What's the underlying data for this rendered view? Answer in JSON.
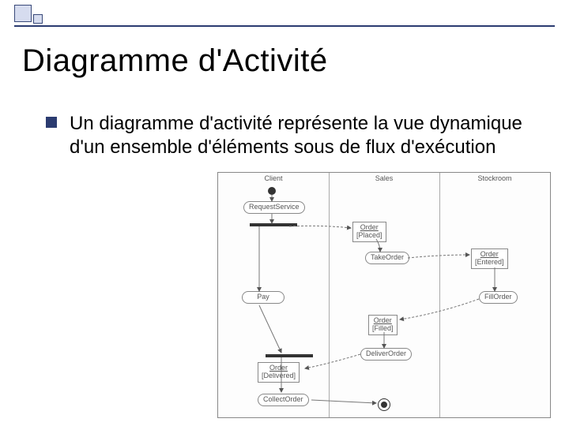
{
  "slide": {
    "title": "Diagramme d'Activité",
    "body": "Un diagramme d'activité représente la vue dynamique d'un ensemble d'éléments sous de flux d'exécution"
  },
  "diagram": {
    "lanes": [
      "Client",
      "Sales",
      "Stockroom"
    ],
    "activities": {
      "request": "RequestService",
      "pay": "Pay",
      "take": "TakeOrder",
      "deliver": "DeliverOrder",
      "fill": "FillOrder",
      "collect": "CollectOrder"
    },
    "objects": {
      "placed": {
        "name": "Order",
        "state": "[Placed]"
      },
      "entered": {
        "name": "Order",
        "state": "[Entered]"
      },
      "filled": {
        "name": "Order",
        "state": "[Filled]"
      },
      "delivered": {
        "name": "Order",
        "state": "[Delivered]"
      }
    }
  }
}
